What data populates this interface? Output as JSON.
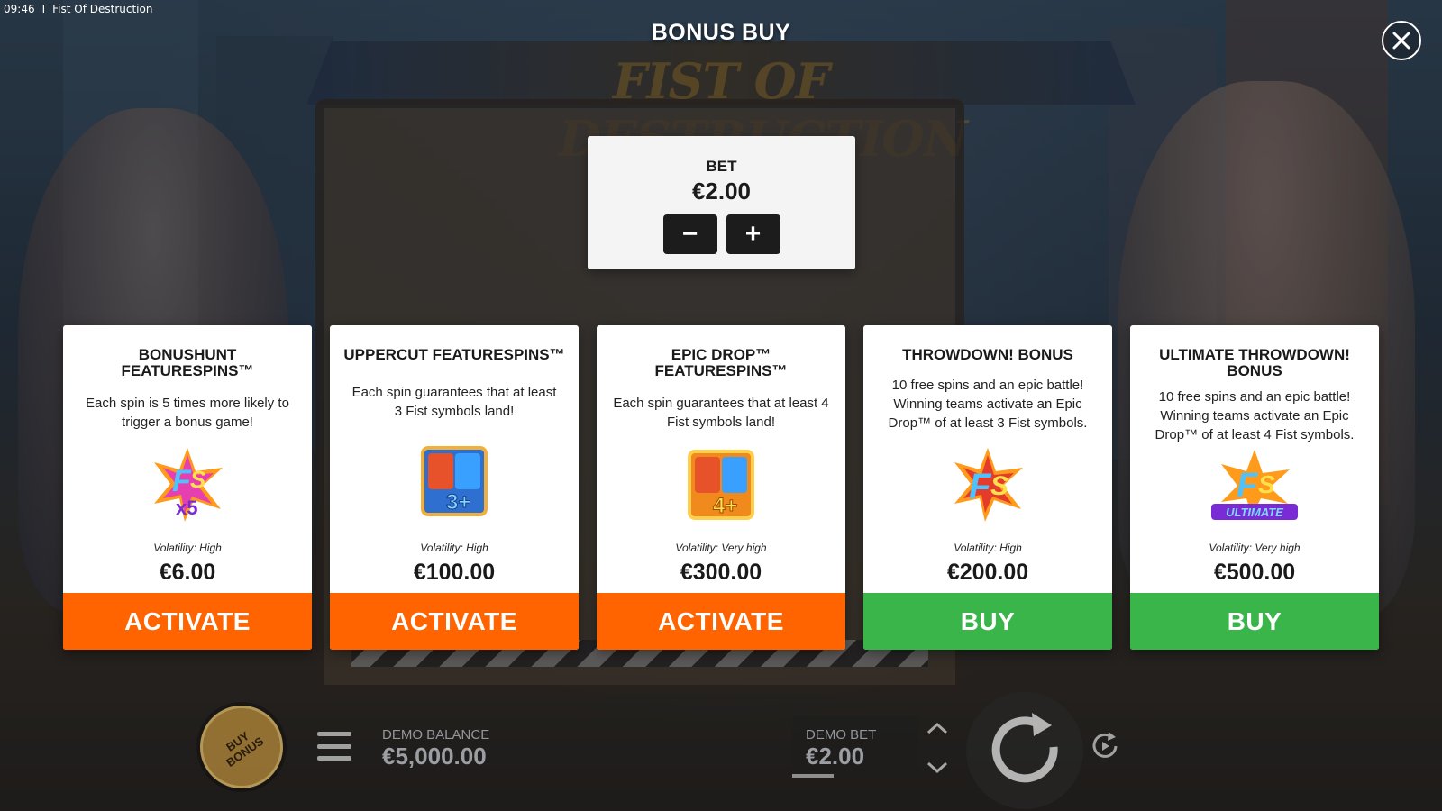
{
  "status_bar": {
    "time": "09:46",
    "separator": "I",
    "app_title": "Fist Of Destruction"
  },
  "header": {
    "title": "BONUS BUY",
    "close_icon": "close-icon",
    "background_logo": "FIST OF DESTRUCTION"
  },
  "bet_panel": {
    "label": "BET",
    "value": "€2.00",
    "decrease_symbol": "−",
    "increase_symbol": "+"
  },
  "cards": [
    {
      "title": "BONUSHUNT FEATURESPINS™",
      "description": "Each spin is 5 times more likely to trigger a bonus game!",
      "icon": "fs-x5-icon",
      "icon_text": "x5",
      "volatility": "Volatility: High",
      "price": "€6.00",
      "button": "ACTIVATE",
      "button_color": "#ff6400"
    },
    {
      "title": "UPPERCUT FEATURESPINS™",
      "description": "Each spin guarantees that at least 3 Fist symbols land!",
      "icon": "fist-3plus-icon",
      "icon_text": "3+",
      "volatility": "Volatility: High",
      "price": "€100.00",
      "button": "ACTIVATE",
      "button_color": "#ff6400"
    },
    {
      "title": "EPIC DROP™ FEATURESPINS™",
      "description": "Each spin guarantees that at least 4 Fist symbols land!",
      "icon": "fist-4plus-icon",
      "icon_text": "4+",
      "volatility": "Volatility: Very high",
      "price": "€300.00",
      "button": "ACTIVATE",
      "button_color": "#ff6400"
    },
    {
      "title": "THROWDOWN! BONUS",
      "description": "10 free spins and an epic battle! Winning teams activate an Epic Drop™ of at least 3 Fist symbols.",
      "icon": "fs-burst-icon",
      "icon_text": "",
      "volatility": "Volatility: High",
      "price": "€200.00",
      "button": "BUY",
      "button_color": "#3ab54a"
    },
    {
      "title": "ULTIMATE THROWDOWN! BONUS",
      "description": "10 free spins and an epic battle! Winning teams activate an Epic Drop™ of at least 4 Fist symbols.",
      "icon": "fs-ultimate-icon",
      "icon_text": "ULTIMATE",
      "volatility": "Volatility: Very high",
      "price": "€500.00",
      "button": "BUY",
      "button_color": "#3ab54a"
    }
  ],
  "bottom_bar": {
    "buy_bonus_label": "BUY BONUS",
    "menu_icon": "hamburger-menu-icon",
    "balance_label": "DEMO BALANCE",
    "balance_value": "€5,000.00",
    "bet_label": "DEMO BET",
    "bet_value": "€2.00",
    "bet_up_icon": "chevron-up-icon",
    "bet_down_icon": "chevron-down-icon",
    "spin_icon": "spin-arrow-icon",
    "autoplay_icon": "autoplay-icon"
  },
  "colors": {
    "activate": "#ff6400",
    "buy": "#3ab54a",
    "panel": "#ffffff",
    "overlay": "#0f1218"
  }
}
